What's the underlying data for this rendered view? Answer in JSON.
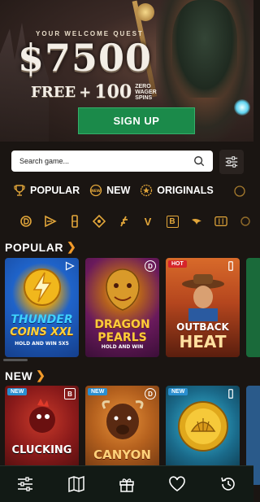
{
  "hero": {
    "welcome": "YOUR WELCOME QUEST",
    "amount": "$7500",
    "free": "FREE",
    "plus": "+",
    "spins_count": "100",
    "zero": "ZERO",
    "wager": "WAGER",
    "spins": "SPINS",
    "signup_label": "SIGN UP"
  },
  "search": {
    "placeholder": "Search game..."
  },
  "categories": [
    {
      "label": "POPULAR",
      "icon": "trophy-icon"
    },
    {
      "label": "NEW",
      "icon": "new-badge-icon"
    },
    {
      "label": "ORIGINALS",
      "icon": "star-badge-icon"
    }
  ],
  "providers": [
    {
      "icon": "provider-d-icon",
      "glyph": ""
    },
    {
      "icon": "provider-arrows-icon",
      "glyph": ""
    },
    {
      "icon": "provider-slot-icon",
      "glyph": ""
    },
    {
      "icon": "provider-diamond-icon",
      "glyph": ""
    },
    {
      "icon": "provider-f-icon",
      "glyph": ""
    },
    {
      "icon": "provider-v-icon",
      "glyph": "V"
    },
    {
      "icon": "provider-b-icon",
      "glyph": "B"
    },
    {
      "icon": "provider-bird-icon",
      "glyph": ""
    },
    {
      "icon": "provider-reels-icon",
      "glyph": ""
    },
    {
      "icon": "provider-extra-icon",
      "glyph": ""
    }
  ],
  "sections": {
    "popular": {
      "title": "POPULAR",
      "games": [
        {
          "title": "THUNDER COINS XXL",
          "line1": "THUNDER",
          "line2": "COINS XXL",
          "sub": "HOLD AND WIN 5X5",
          "badge": "",
          "bg": "#1f63c9"
        },
        {
          "title": "DRAGON PEARLS",
          "line1": "DRAGON",
          "line2": "PEARLS",
          "sub": "HOLD AND WIN",
          "badge": "",
          "bg": "#6a1a5c"
        },
        {
          "title": "OUTBACK HEAT",
          "line1": "OUTBACK",
          "line2": "HEAT",
          "sub": "",
          "badge": "HOT",
          "bg": "#c0551f"
        }
      ]
    },
    "new": {
      "title": "NEW",
      "games": [
        {
          "title": "CLUCKING",
          "line1": "CLUCKING",
          "line2": "",
          "sub": "",
          "badge": "NEW",
          "bg": "#8a1a1a"
        },
        {
          "title": "CANYON",
          "line1": "CANYON",
          "line2": "",
          "sub": "",
          "badge": "NEW",
          "bg": "#b5611e"
        },
        {
          "title": "",
          "line1": "",
          "line2": "",
          "sub": "",
          "badge": "NEW",
          "bg": "#1a6a8a"
        }
      ]
    }
  },
  "bottom_nav": [
    {
      "icon": "sliders-icon"
    },
    {
      "icon": "map-icon"
    },
    {
      "icon": "gift-icon"
    },
    {
      "icon": "heart-icon"
    },
    {
      "icon": "history-icon"
    }
  ]
}
